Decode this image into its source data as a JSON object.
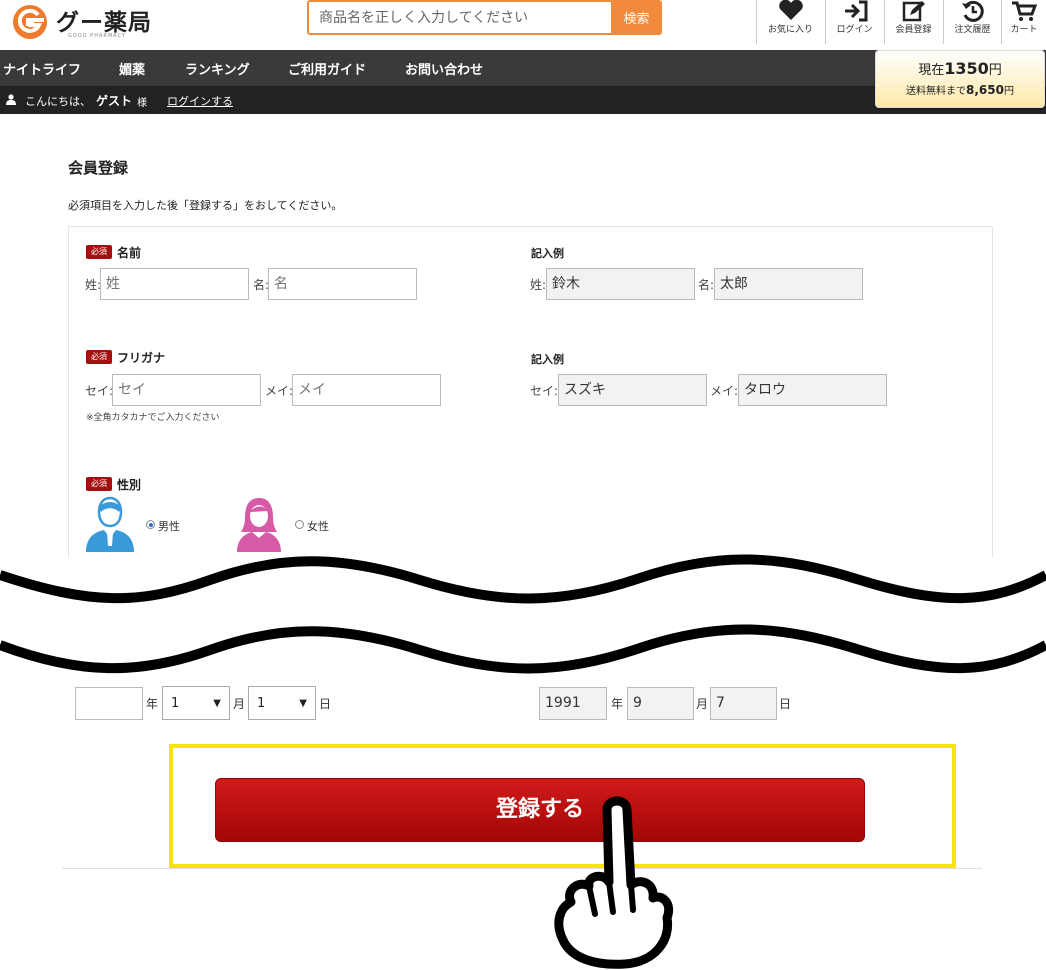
{
  "header": {
    "logo_text": "グー薬局",
    "logo_sub": "GOOD PHARMACY",
    "search_placeholder": "商品名を正しく入力してください",
    "search_button": "検索",
    "icons": [
      {
        "label": "お気に入り",
        "icon": "heart-icon"
      },
      {
        "label": "ログイン",
        "icon": "login-icon"
      },
      {
        "label": "会員登録",
        "icon": "edit-icon"
      },
      {
        "label": "注文履歴",
        "icon": "history-icon"
      },
      {
        "label": "カート",
        "icon": "cart-icon"
      }
    ]
  },
  "nav": {
    "items": [
      "ナイトライフ",
      "媚薬",
      "ランキング",
      "ご利用ガイド",
      "お問い合わせ"
    ]
  },
  "greeting": {
    "text": "こんにちは、",
    "name": "ゲスト",
    "suffix": "様",
    "login_link": "ログインする"
  },
  "cart": {
    "current_prefix": "現在",
    "current_amount": "1350",
    "current_unit": "円",
    "free_prefix": "送料無料まで",
    "free_amount": "8,650",
    "free_unit": "円"
  },
  "page": {
    "title": "会員登録",
    "description": "必須項目を入力した後「登録する」をおしてください。"
  },
  "form": {
    "required_badge": "必須",
    "example_label": "記入例",
    "name": {
      "label": "名前",
      "last_label": "姓:",
      "last_placeholder": "姓",
      "first_label": "名:",
      "first_placeholder": "名",
      "example_last": "鈴木",
      "example_first": "太郎"
    },
    "furigana": {
      "label": "フリガナ",
      "last_label": "セイ:",
      "last_placeholder": "セイ",
      "first_label": "メイ:",
      "first_placeholder": "メイ",
      "example_last": "スズキ",
      "example_first": "タロウ",
      "note": "※全角カタカナでご入力ください"
    },
    "gender": {
      "label": "性別",
      "male": "男性",
      "female": "女性"
    },
    "birthday": {
      "year_unit": "年",
      "month_unit": "月",
      "day_unit": "日",
      "month_value": "1",
      "day_value": "1",
      "example_year": "1991",
      "example_month": "9",
      "example_day": "7"
    },
    "submit": "登録する"
  }
}
